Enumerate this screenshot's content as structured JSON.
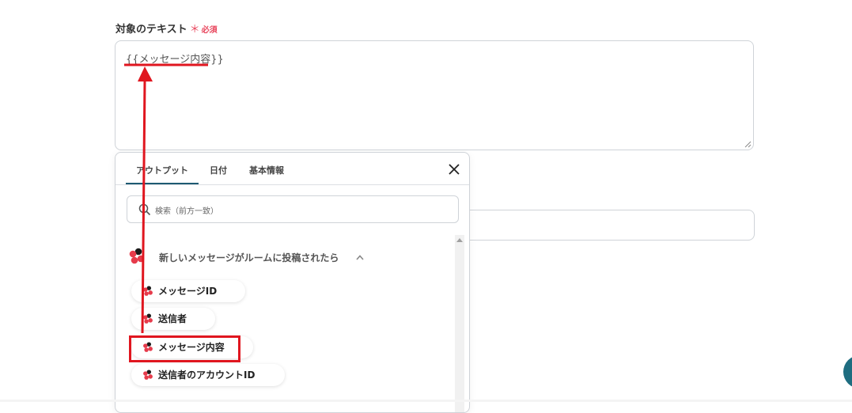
{
  "field": {
    "label": "対象のテキスト",
    "required_star": "＊",
    "required_text": "必須",
    "value": "{{メッセージ内容}}"
  },
  "popup": {
    "tabs": [
      {
        "label": "アウトプット",
        "active": true
      },
      {
        "label": "日付",
        "active": false
      },
      {
        "label": "基本情報",
        "active": false
      }
    ],
    "search": {
      "placeholder": "検索（前方一致）"
    },
    "group": {
      "title": "新しいメッセージがルームに投稿されたら",
      "expanded": true,
      "items": [
        {
          "label": "メッセージID"
        },
        {
          "label": "送信者"
        },
        {
          "label": "メッセージ内容",
          "highlighted": true
        },
        {
          "label": "送信者のアカウントID"
        }
      ]
    }
  },
  "colors": {
    "accent": "#1e5a72",
    "required": "#e8455c",
    "annotation_red": "#e0161f",
    "logo_red": "#e63b4b",
    "logo_dark": "#1a1a1a",
    "fab": "#1e6d80"
  },
  "icons": {
    "close": "close-icon",
    "search": "search-icon",
    "chevron": "chevron-up-icon",
    "app_logo": "chatwork-logo-icon"
  }
}
